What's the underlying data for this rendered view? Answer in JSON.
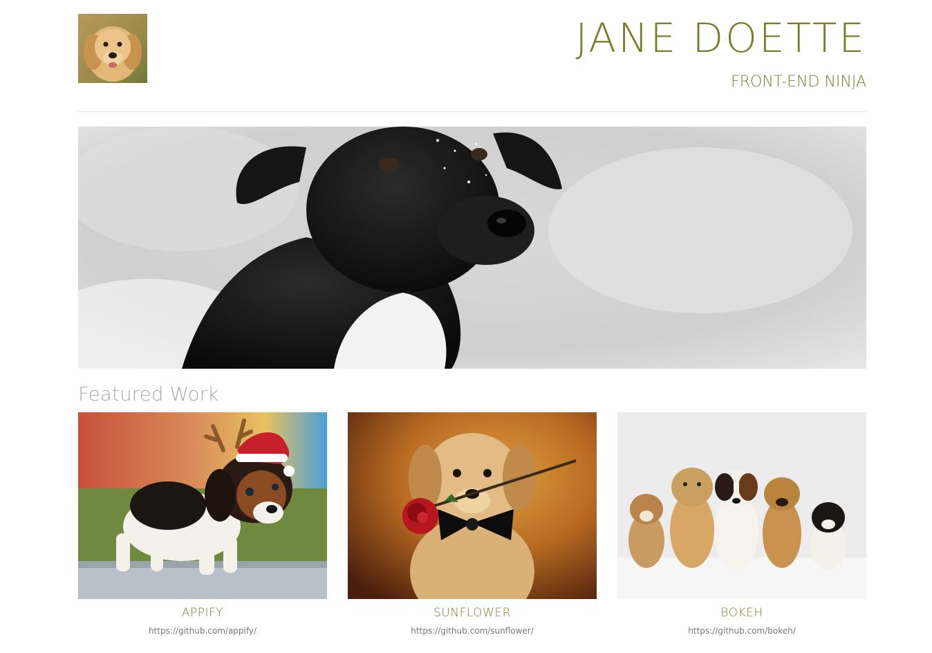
{
  "header": {
    "name": "JANE DOETTE",
    "tagline": "FRONT-END NINJA",
    "avatar_icon": "puppy-avatar-image"
  },
  "hero": {
    "image": "black-puppy-in-snow-photo"
  },
  "featured": {
    "heading": "Featured Work",
    "items": [
      {
        "title": "APPIFY",
        "url": "https://github.com/appify/",
        "image": "beagle-puppy-with-reindeer-antlers-photo"
      },
      {
        "title": "SUNFLOWER",
        "url": "https://github.com/sunflower/",
        "image": "golden-puppy-with-rose-photo"
      },
      {
        "title": "BOKEH",
        "url": "https://github.com/bokeh/",
        "image": "five-puppies-lined-up-photo"
      }
    ]
  },
  "colors": {
    "accent": "#7b7c2a",
    "heading_gray": "#aaaaaa",
    "link_gray": "#777777",
    "divider": "#e6e6e6"
  }
}
